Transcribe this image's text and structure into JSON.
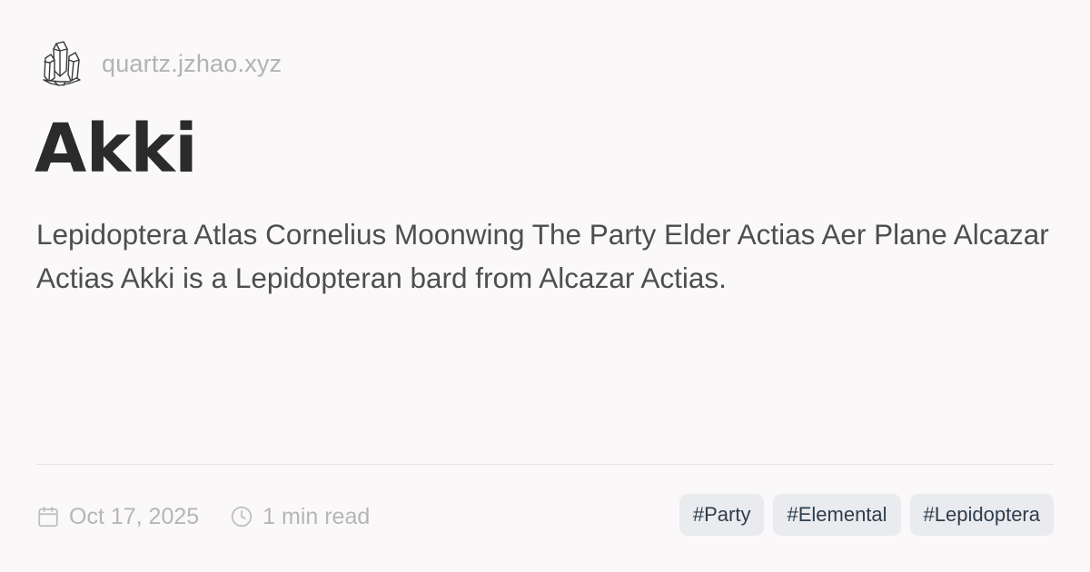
{
  "site": {
    "name": "quartz.jzhao.xyz",
    "logo_icon": "crystal-logo-icon"
  },
  "page": {
    "title": "Akki",
    "description": "Lepidoptera Atlas Cornelius Moonwing The Party Elder Actias Aer Plane Alcazar Actias Akki is a Lepidopteran bard from Alcazar Actias."
  },
  "meta": {
    "date": "Oct 17, 2025",
    "date_icon": "calendar-icon",
    "reading_time": "1 min read",
    "reading_time_icon": "clock-icon"
  },
  "tags": [
    "#Party",
    "#Elemental",
    "#Lepidoptera"
  ],
  "colors": {
    "background": "#faf8f8",
    "title": "#2b2b2b",
    "text": "#4e4e4e",
    "muted": "#b3b3b3",
    "tag_background": "#e9ebee",
    "tag_text": "#2f3e4d"
  }
}
